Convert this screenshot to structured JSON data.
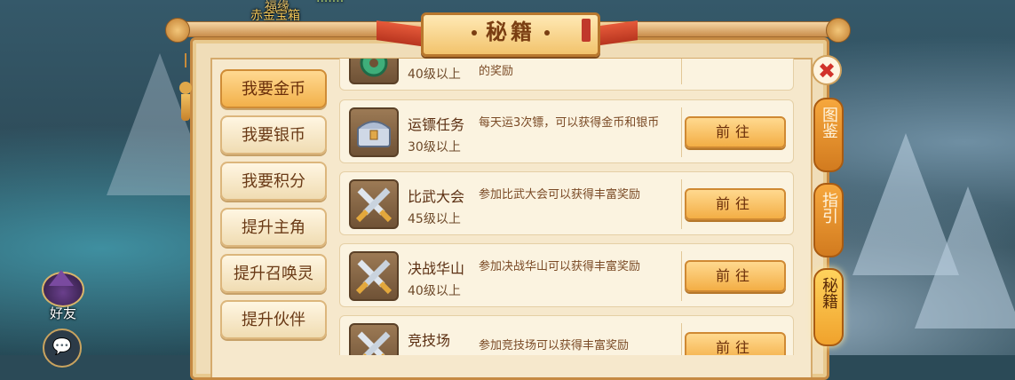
{
  "top_labels": {
    "line1": "福缘",
    "line2": "赤金宝箱"
  },
  "window_title": "秘籍",
  "menu": [
    {
      "label": "我要金币",
      "active": true
    },
    {
      "label": "我要银币",
      "active": false
    },
    {
      "label": "我要积分",
      "active": false
    },
    {
      "label": "提升主角",
      "active": false
    },
    {
      "label": "提升召唤灵",
      "active": false
    },
    {
      "label": "提升伙伴",
      "active": false
    }
  ],
  "rows": [
    {
      "name": "",
      "level": "40级以上",
      "desc": "的奖励",
      "button": "",
      "icon": "jade-coin-icon"
    },
    {
      "name": "运镖任务",
      "level": "30级以上",
      "desc": "每天运3次镖，可以获得金币和银币",
      "button": "前往",
      "icon": "treasure-chest-icon"
    },
    {
      "name": "比武大会",
      "level": "45级以上",
      "desc": "参加比武大会可以获得丰富奖励",
      "button": "前往",
      "icon": "crossed-swords-icon"
    },
    {
      "name": "决战华山",
      "level": "40级以上",
      "desc": "参加决战华山可以获得丰富奖励",
      "button": "前往",
      "icon": "crossed-swords-icon"
    },
    {
      "name": "竞技场",
      "level": "",
      "desc": "参加竞技场可以获得丰富奖励",
      "button": "前往",
      "icon": "crossed-swords-icon"
    }
  ],
  "side_tabs": [
    {
      "label": "图鉴",
      "active": false
    },
    {
      "label": "指引",
      "active": false
    },
    {
      "label": "秘籍",
      "active": true
    }
  ],
  "friend_label": "好友",
  "close_glyph": "✖",
  "chat_glyph": "💬",
  "colors": {
    "accent": "#f3ae45",
    "panel_bg": "#f6e8cc",
    "title_text": "#7a3e12",
    "close_x": "#d1322a"
  }
}
